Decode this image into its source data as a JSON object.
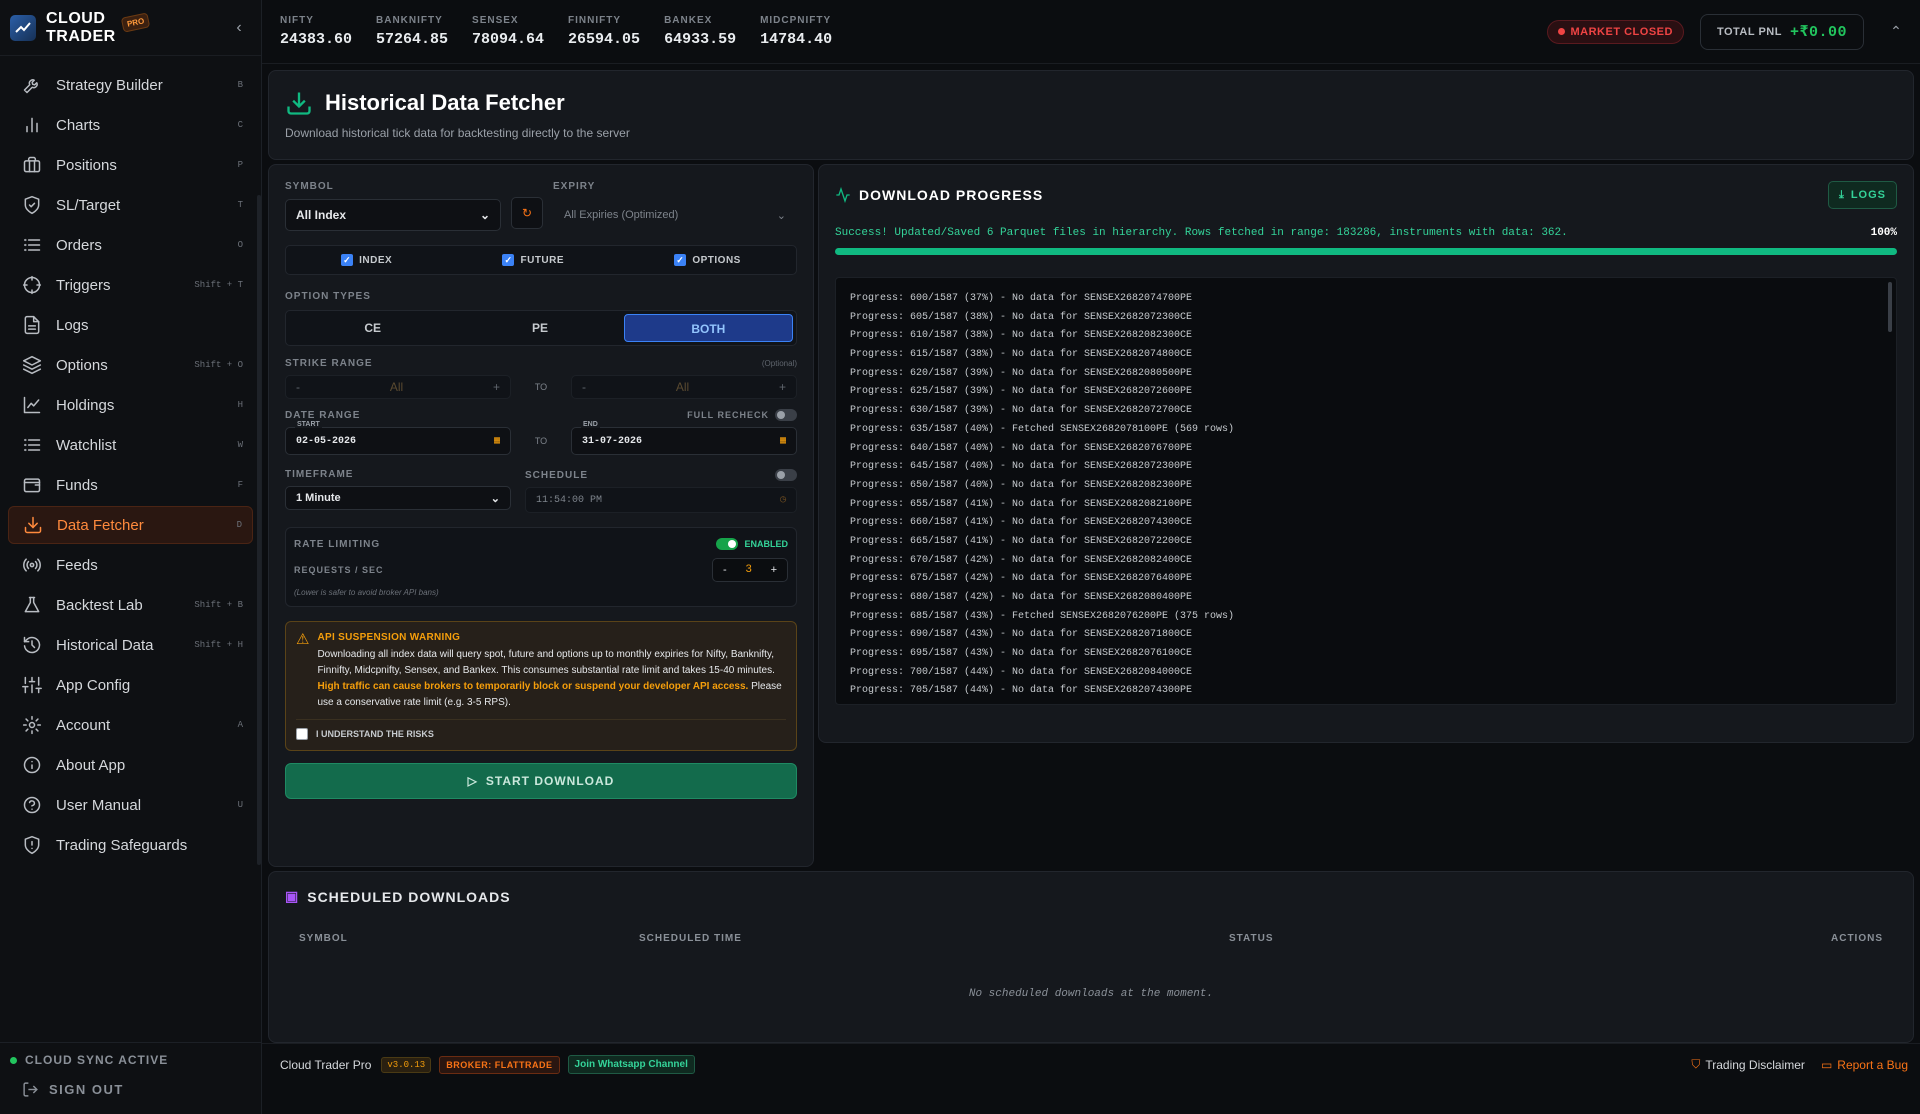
{
  "brand": {
    "line1": "CLOUD",
    "line2": "TRADER",
    "badge": "PRO"
  },
  "nav": [
    {
      "label": "Strategy Builder",
      "shortcut": "B",
      "icon": "wrench-icon"
    },
    {
      "label": "Charts",
      "shortcut": "C",
      "icon": "bar-chart-icon"
    },
    {
      "label": "Positions",
      "shortcut": "P",
      "icon": "briefcase-icon"
    },
    {
      "label": "SL/Target",
      "shortcut": "T",
      "icon": "shield-check-icon"
    },
    {
      "label": "Orders",
      "shortcut": "O",
      "icon": "list-icon"
    },
    {
      "label": "Triggers",
      "shortcut": "Shift + T",
      "icon": "crosshair-icon"
    },
    {
      "label": "Logs",
      "shortcut": "",
      "icon": "file-text-icon"
    },
    {
      "label": "Options",
      "shortcut": "Shift + O",
      "icon": "layers-icon"
    },
    {
      "label": "Holdings",
      "shortcut": "H",
      "icon": "line-chart-icon"
    },
    {
      "label": "Watchlist",
      "shortcut": "W",
      "icon": "list-icon"
    },
    {
      "label": "Funds",
      "shortcut": "F",
      "icon": "wallet-icon"
    },
    {
      "label": "Data Fetcher",
      "shortcut": "D",
      "icon": "download-icon",
      "active": true
    },
    {
      "label": "Feeds",
      "shortcut": "",
      "icon": "broadcast-icon"
    },
    {
      "label": "Backtest Lab",
      "shortcut": "Shift + B",
      "icon": "flask-icon"
    },
    {
      "label": "Historical Data",
      "shortcut": "Shift + H",
      "icon": "history-icon"
    },
    {
      "label": "App Config",
      "shortcut": "",
      "icon": "sliders-icon"
    },
    {
      "label": "Account",
      "shortcut": "A",
      "icon": "gear-icon"
    },
    {
      "label": "About App",
      "shortcut": "",
      "icon": "info-icon"
    },
    {
      "label": "User Manual",
      "shortcut": "U",
      "icon": "help-icon"
    },
    {
      "label": "Trading Safeguards",
      "shortcut": "",
      "icon": "shield-alert-icon"
    }
  ],
  "sidebar_footer": {
    "sync": "CLOUD SYNC ACTIVE",
    "signout": "SIGN OUT"
  },
  "ticker": [
    {
      "name": "NIFTY",
      "value": "24383.60"
    },
    {
      "name": "BANKNIFTY",
      "value": "57264.85"
    },
    {
      "name": "SENSEX",
      "value": "78094.64"
    },
    {
      "name": "FINNIFTY",
      "value": "26594.05"
    },
    {
      "name": "BANKEX",
      "value": "64933.59"
    },
    {
      "name": "MIDCPNIFTY",
      "value": "14784.40"
    }
  ],
  "topbar": {
    "market_status": "MARKET CLOSED",
    "pnl_label": "TOTAL PNL",
    "pnl_value": "+₹0.00"
  },
  "page": {
    "title": "Historical Data Fetcher",
    "subtitle": "Download historical tick data for backtesting directly to the server"
  },
  "form": {
    "symbol_label": "SYMBOL",
    "symbol_value": "All Index",
    "expiry_label": "EXPIRY",
    "expiry_value": "All Expiries (Optimized)",
    "checks": [
      "INDEX",
      "FUTURE",
      "OPTIONS"
    ],
    "option_types_label": "OPTION TYPES",
    "option_types": [
      "CE",
      "PE",
      "BOTH"
    ],
    "strike_label": "STRIKE RANGE",
    "strike_optional": "(Optional)",
    "strike_from": "All",
    "strike_to": "All",
    "to": "TO",
    "date_label": "DATE RANGE",
    "full_recheck": "FULL RECHECK",
    "start_label": "START",
    "start": "02-05-2026",
    "end_label": "END",
    "end": "31-07-2026",
    "timeframe_label": "TIMEFRAME",
    "timeframe": "1 Minute",
    "schedule_label": "SCHEDULE",
    "schedule_time": "11:54:00 PM",
    "rate_label": "RATE LIMITING",
    "rate_enabled": "ENABLED",
    "rps_label": "REQUESTS / SEC",
    "rps": "3",
    "rate_note": "(Lower is safer to avoid broker API bans)",
    "warn_title": "API SUSPENSION WARNING",
    "warn_body": "Downloading all index data will query spot, future and options up to monthly expiries for Nifty, Banknifty, Finnifty, Midcpnifty, Sensex, and Bankex. This consumes substantial rate limit and takes 15-40 minutes.",
    "warn_highlight": "High traffic can cause brokers to temporarily block or suspend your developer API access.",
    "warn_tail": "Please use a conservative rate limit (e.g. 3-5 RPS).",
    "understand": "I UNDERSTAND THE RISKS",
    "start_button": "START DOWNLOAD"
  },
  "progress": {
    "title": "DOWNLOAD PROGRESS",
    "logs_button": "LOGS",
    "success": "Success! Updated/Saved 6 Parquet files in hierarchy. Rows fetched in range: 183286, instruments with data: 362.",
    "percent": "100%",
    "fraction": 1.0,
    "lines": [
      "Progress: 600/1587 (37%) - No data for SENSEX2682074700PE",
      "Progress: 605/1587 (38%) - No data for SENSEX2682072300CE",
      "Progress: 610/1587 (38%) - No data for SENSEX2682082300CE",
      "Progress: 615/1587 (38%) - No data for SENSEX2682074800CE",
      "Progress: 620/1587 (39%) - No data for SENSEX2682080500PE",
      "Progress: 625/1587 (39%) - No data for SENSEX2682072600PE",
      "Progress: 630/1587 (39%) - No data for SENSEX2682072700CE",
      "Progress: 635/1587 (40%) - Fetched SENSEX2682078100PE (569 rows)",
      "Progress: 640/1587 (40%) - No data for SENSEX2682076700PE",
      "Progress: 645/1587 (40%) - No data for SENSEX2682072300PE",
      "Progress: 650/1587 (40%) - No data for SENSEX2682082300PE",
      "Progress: 655/1587 (41%) - No data for SENSEX2682082100PE",
      "Progress: 660/1587 (41%) - No data for SENSEX2682074300CE",
      "Progress: 665/1587 (41%) - No data for SENSEX2682072200CE",
      "Progress: 670/1587 (42%) - No data for SENSEX2682082400CE",
      "Progress: 675/1587 (42%) - No data for SENSEX2682076400PE",
      "Progress: 680/1587 (42%) - No data for SENSEX2682080400PE",
      "Progress: 685/1587 (43%) - Fetched SENSEX2682076200PE (375 rows)",
      "Progress: 690/1587 (43%) - No data for SENSEX2682071800CE",
      "Progress: 695/1587 (43%) - No data for SENSEX2682076100CE",
      "Progress: 700/1587 (44%) - No data for SENSEX2682084000CE",
      "Progress: 705/1587 (44%) - No data for SENSEX2682074300PE"
    ]
  },
  "scheduled": {
    "title": "SCHEDULED DOWNLOADS",
    "cols": [
      "SYMBOL",
      "SCHEDULED TIME",
      "STATUS",
      "ACTIONS"
    ],
    "empty": "No scheduled downloads at the moment."
  },
  "footer": {
    "app": "Cloud Trader Pro",
    "version": "v3.0.13",
    "broker": "BROKER: FLATTRADE",
    "whatsapp": "Join Whatsapp Channel",
    "disclaimer": "Trading Disclaimer",
    "bug": "Report a Bug"
  }
}
